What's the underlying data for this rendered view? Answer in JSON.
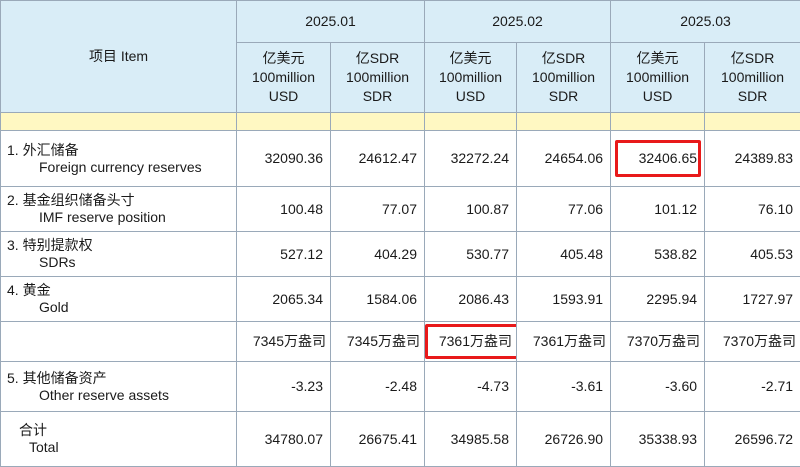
{
  "header": {
    "item_label": "项目 Item",
    "months": [
      "2025.01",
      "2025.02",
      "2025.03"
    ],
    "units": [
      {
        "zh": "亿美元",
        "en1": "100million",
        "en2": "USD"
      },
      {
        "zh": "亿SDR",
        "en1": "100million",
        "en2": "SDR"
      }
    ]
  },
  "rows": [
    {
      "zh": "1. 外汇储备",
      "en": "Foreign currency reserves",
      "values": [
        "32090.36",
        "24612.47",
        "32272.24",
        "24654.06",
        "32406.65",
        "24389.83"
      ]
    },
    {
      "zh": "2. 基金组织储备头寸",
      "en": "IMF reserve position",
      "values": [
        "100.48",
        "77.07",
        "100.87",
        "77.06",
        "101.12",
        "76.10"
      ]
    },
    {
      "zh": "3. 特别提款权",
      "en": "SDRs",
      "values": [
        "527.12",
        "404.29",
        "530.77",
        "405.48",
        "538.82",
        "405.53"
      ]
    },
    {
      "zh": "4. 黄金",
      "en": "Gold",
      "values": [
        "2065.34",
        "1584.06",
        "2086.43",
        "1593.91",
        "2295.94",
        "1727.97"
      ]
    },
    {
      "zh": "",
      "en": "",
      "values": [
        "7345万盎司",
        "7345万盎司",
        "7361万盎司",
        "7361万盎司",
        "7370万盎司",
        "7370万盎司"
      ]
    },
    {
      "zh": "5. 其他储备资产",
      "en": "Other reserve assets",
      "values": [
        "-3.23",
        "-2.48",
        "-4.73",
        "-3.61",
        "-3.60",
        "-2.71"
      ]
    },
    {
      "zh": "合计",
      "en": "Total",
      "values": [
        "34780.07",
        "26675.41",
        "34985.58",
        "26726.90",
        "35338.93",
        "26596.72"
      ]
    }
  ],
  "highlight_color": "#e8191a",
  "header_bg": "#d9edf7",
  "band_bg": "#fff8c2"
}
